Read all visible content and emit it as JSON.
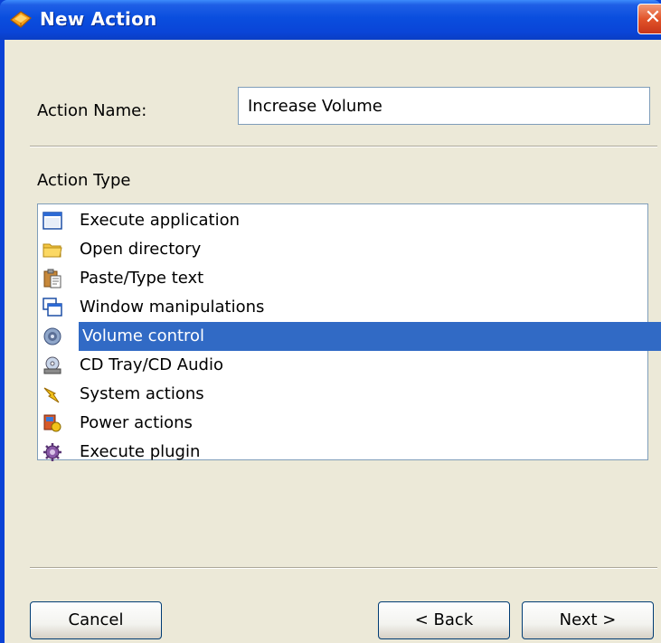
{
  "window": {
    "title": "New Action",
    "title_icon": "new-action-icon",
    "close_label": "✕"
  },
  "form": {
    "action_name_label": "Action Name:",
    "action_name_value": "Increase Volume",
    "action_type_label": "Action Type"
  },
  "action_types": [
    {
      "label": "Execute application",
      "icon": "application-window-icon"
    },
    {
      "label": "Open directory",
      "icon": "folder-icon"
    },
    {
      "label": "Paste/Type text",
      "icon": "clipboard-icon"
    },
    {
      "label": "Window manipulations",
      "icon": "windows-icon"
    },
    {
      "label": "Volume control",
      "icon": "speaker-icon",
      "selected": true
    },
    {
      "label": "CD Tray/CD Audio",
      "icon": "cd-drive-icon"
    },
    {
      "label": "System actions",
      "icon": "lightning-icon"
    },
    {
      "label": "Power actions",
      "icon": "power-icon"
    },
    {
      "label": "Execute plugin",
      "icon": "gear-plugin-icon"
    }
  ],
  "buttons": {
    "cancel": "Cancel",
    "back": "< Back",
    "next": "Next >"
  },
  "colors": {
    "titlebar": "#0a4ede",
    "selection": "#316ac5",
    "close": "#e2542a",
    "client": "#ece9d8"
  }
}
